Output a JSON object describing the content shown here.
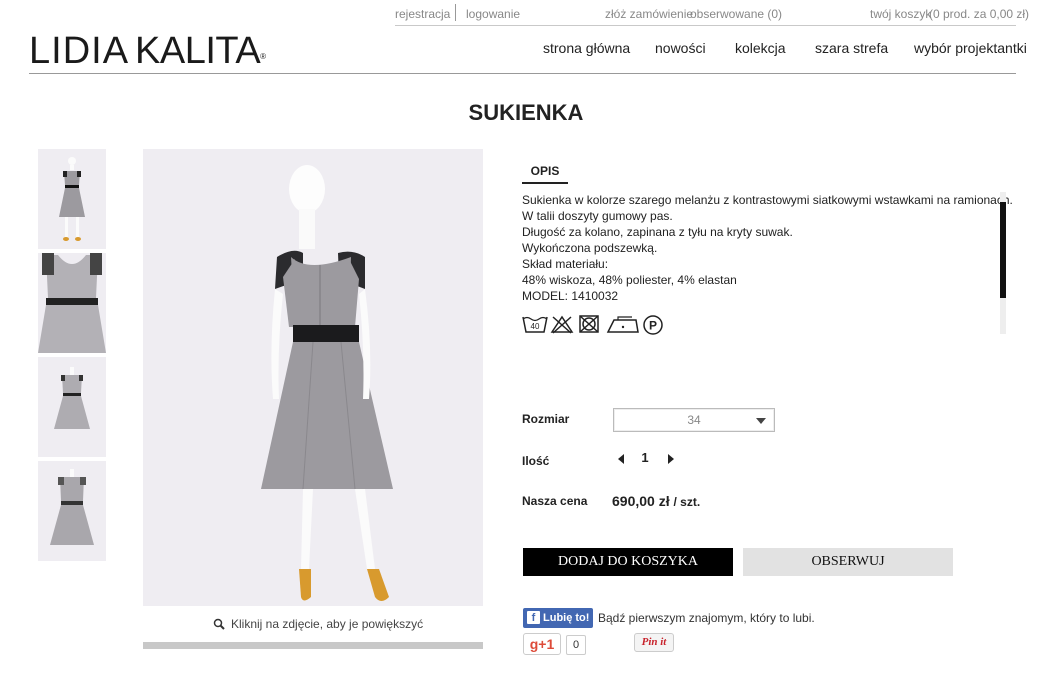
{
  "header": {
    "utility": {
      "register": "rejestracja",
      "login": "logowanie",
      "place_order": "złóż zamówienie",
      "watched": "obserwowane (0)",
      "cart": "twój koszyk",
      "cart_summary": "(0 prod. za 0,00 zł)"
    },
    "logo": {
      "part1": "LIDIA",
      "part2": "KALITA",
      "mark": "®"
    },
    "nav": [
      "strona główna",
      "nowości",
      "kolekcja",
      "szara strefa",
      "wybór projektantki"
    ]
  },
  "product": {
    "title": "SUKIENKA",
    "zoom_hint": "Kliknij na zdjęcie, aby je powiększyć",
    "tab_label": "OPIS",
    "description_lines": [
      "Sukienka w kolorze szarego melanżu z kontrastowymi siatkowymi wstawkami na ramionach.",
      "W talii doszyty gumowy pas.",
      "Długość za kolano, zapinana z tyłu na kryty suwak.",
      "Wykończona podszewką.",
      "Skład materiału:",
      "48% wiskoza, 48% poliester, 4% elastan",
      "MODEL: 1410032"
    ],
    "care_icons": [
      "wash-40-icon",
      "no-bleach-icon",
      "no-tumble-dry-icon",
      "iron-low-icon",
      "dry-clean-p-icon"
    ],
    "care_wash_temp": "40",
    "care_dry_clean": "P",
    "size_label": "Rozmiar",
    "size_value": "34",
    "qty_label": "Ilość",
    "qty_value": "1",
    "price_label": "Nasza cena",
    "price": "690,00 zł",
    "price_unit": "/ szt.",
    "add_to_cart": "DODAJ DO KOSZYKA",
    "watch": "OBSERWUJ",
    "scroll_fraction": 0.68
  },
  "social": {
    "fb_like": "Lubię to!",
    "fb_text": "Bądź pierwszym znajomym, który to lubi.",
    "gplus": "g+1",
    "gplus_count": "0",
    "pinterest": "Pin it"
  },
  "colors": {
    "photo_bg": "#efedf2",
    "dress": "#9c9a9f",
    "shoes": "#d89a2e",
    "button_black": "#000000",
    "button_grey": "#e2e2e2",
    "facebook": "#4267b2"
  }
}
